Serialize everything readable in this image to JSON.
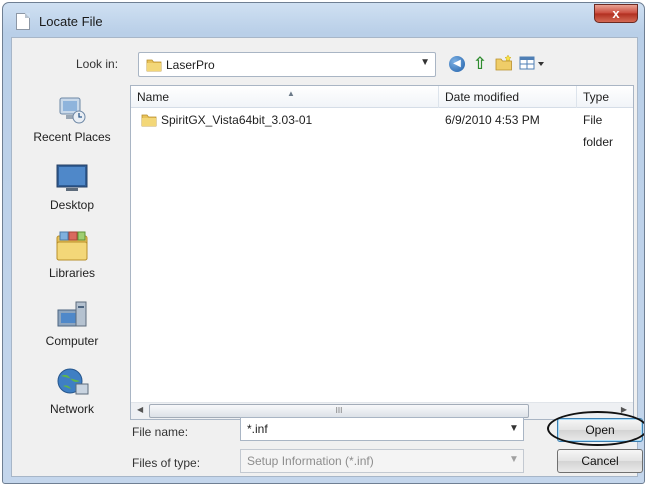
{
  "window": {
    "title": "Locate File",
    "close_label": "x"
  },
  "toolbar": {
    "look_in_label": "Look in:",
    "look_in_value": "LaserPro",
    "icons": [
      "back-icon",
      "up-folder-icon",
      "new-folder-icon",
      "views-menu-icon"
    ]
  },
  "sidebar": {
    "items": [
      {
        "label": "Recent Places",
        "icon": "recent-places-icon"
      },
      {
        "label": "Desktop",
        "icon": "desktop-icon"
      },
      {
        "label": "Libraries",
        "icon": "libraries-icon"
      },
      {
        "label": "Computer",
        "icon": "computer-icon"
      },
      {
        "label": "Network",
        "icon": "network-icon"
      }
    ]
  },
  "filelist": {
    "columns": [
      "Name",
      "Date modified",
      "Type"
    ],
    "rows": [
      {
        "name": "SpiritGX_Vista64bit_3.03-01",
        "date": "6/9/2010 4:53 PM",
        "type": "File folder"
      }
    ],
    "scroll_grip": "III"
  },
  "form": {
    "file_name_label": "File name:",
    "file_name_value": "*.inf",
    "file_type_label": "Files of type:",
    "file_type_value": "Setup Information (*.inf)"
  },
  "buttons": {
    "open": "Open",
    "cancel": "Cancel"
  },
  "colors": {
    "title_gradient": "#cfe0f2",
    "close_red": "#c9483a",
    "body_bg": "#f0f0f0",
    "folder_yellow": "#e8c25a"
  }
}
